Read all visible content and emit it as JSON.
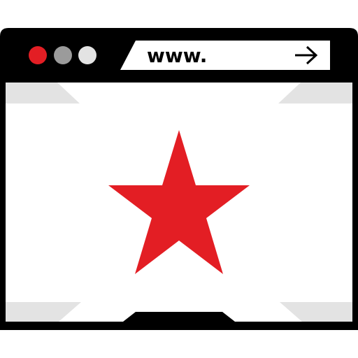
{
  "browser": {
    "address_bar": {
      "text": "www.",
      "go_icon": "arrow-right-icon"
    },
    "window_controls": [
      {
        "name": "close-dot",
        "color": "#E31E24"
      },
      {
        "name": "minimize-dot",
        "color": "#9B9B9B"
      },
      {
        "name": "maximize-dot",
        "color": "#E3E3E3"
      }
    ],
    "content_icon": "star-icon",
    "colors": {
      "frame": "#000000",
      "accent": "#E31E24",
      "panel": "#E3E3E3",
      "page": "#FFFFFF"
    }
  }
}
